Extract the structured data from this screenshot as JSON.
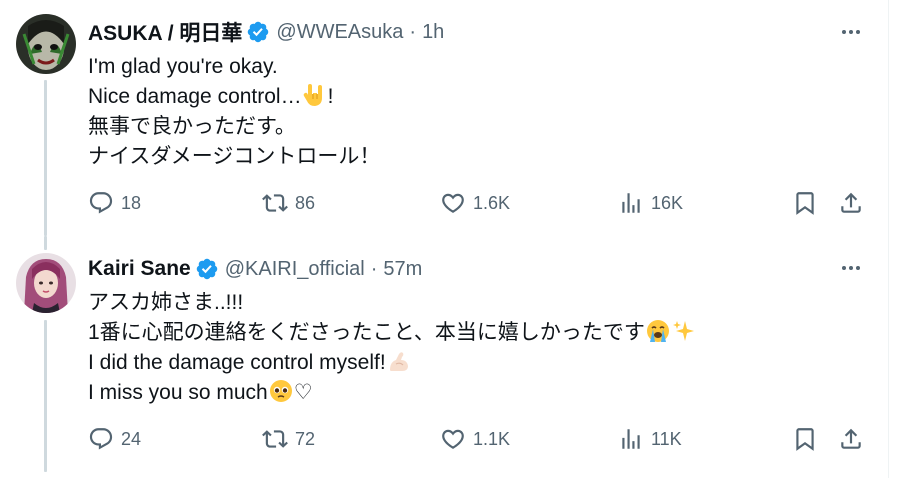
{
  "colors": {
    "verified": "#1d9bf0",
    "text": "#0f1419",
    "muted": "#536471",
    "thread_line": "#cfd9de"
  },
  "tweets": [
    {
      "display_name": "ASUKA / 明日華",
      "handle": "@WWEAsuka",
      "separator": "·",
      "time": "1h",
      "lines": [
        "I'm glad you're okay.",
        "Nice damage control…",
        "無事で良かっただす。",
        "ナイスダメージコントロール！"
      ],
      "line2_suffix": "!",
      "line2_emoji": "love-you-gesture-emoji",
      "reply_count": "18",
      "repost_count": "86",
      "like_count": "1.6K",
      "view_count": "16K"
    },
    {
      "display_name": "Kairi Sane",
      "handle": "@KAIRI_official",
      "separator": "·",
      "time": "57m",
      "lines": [
        "アスカ姉さま..!!!",
        "1番に心配の連絡をくださったこと、本当に嬉しかったです",
        "I did the damage control myself!",
        "I miss you so much"
      ],
      "line4_suffix": "♡",
      "line2_emojis": [
        "loudly-crying-face-emoji",
        "sparkles-emoji"
      ],
      "line3_emoji": "flexed-biceps-emoji",
      "line4_emoji": "pleading-face-emoji",
      "reply_count": "24",
      "repost_count": "72",
      "like_count": "1.1K",
      "view_count": "11K"
    }
  ]
}
